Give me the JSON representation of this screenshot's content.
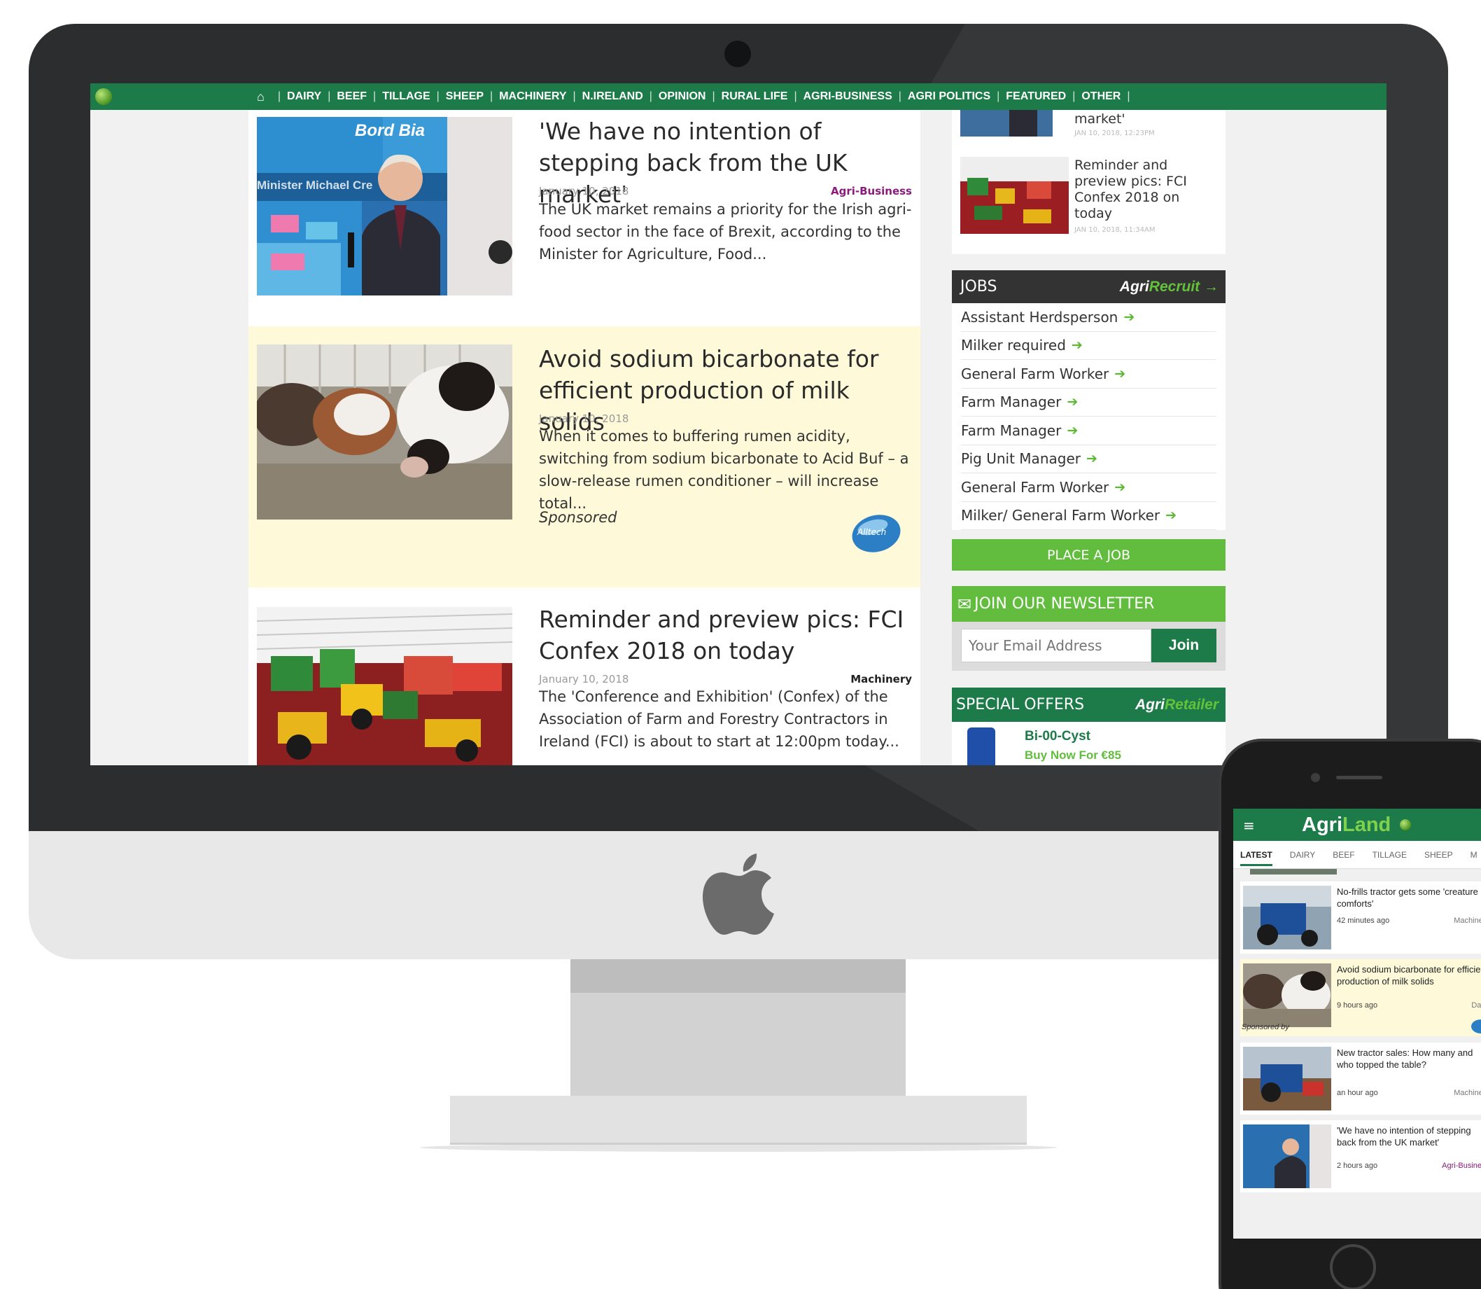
{
  "nav": {
    "home_icon": "home-icon",
    "items": [
      "DAIRY",
      "BEEF",
      "TILLAGE",
      "SHEEP",
      "MACHINERY",
      "N.IRELAND",
      "OPINION",
      "RURAL LIFE",
      "AGRI-BUSINESS",
      "AGRI POLITICS",
      "FEATURED",
      "OTHER"
    ]
  },
  "articles": [
    {
      "title": "'We have no intention of stepping back from the UK market'",
      "date": "January 10, 2018",
      "category": "Agri-Business",
      "category_color": "#8a1c7c",
      "excerpt": "The UK market remains a priority for the Irish agri-food sector in the face of Brexit, according to the Minister for Agriculture, Food...",
      "image_text": "Bord Bia",
      "image_banner": "Minister Michael Cre"
    },
    {
      "title": "Avoid sodium bicarbonate for efficient production of milk solids",
      "date": "January 10, 2018",
      "excerpt": "When it comes to buffering rumen acidity, switching from sodium bicarbonate to Acid Buf – a slow-release rumen conditioner – will increase total...",
      "sponsored_label": "Sponsored",
      "sponsor_logo_text": "Alltech"
    },
    {
      "title": "Reminder and preview pics: FCI Confex 2018 on today",
      "date": "January 10, 2018",
      "category": "Machinery",
      "category_color": "#222222",
      "excerpt": "The 'Conference and Exhibition' (Confex) of the Association of Farm and Forestry Contractors in Ireland (FCI) is about to start at 12:00pm today..."
    }
  ],
  "sidebar": {
    "recent": [
      {
        "title": "market'",
        "meta": "JAN 10, 2018, 12:23PM"
      },
      {
        "title": "Reminder and preview pics: FCI Confex 2018 on today",
        "meta": "JAN 10, 2018, 11:34AM"
      }
    ],
    "jobs": {
      "header": "JOBS",
      "brand_a": "Agri",
      "brand_b": "Recruit",
      "items": [
        "Assistant Herdsperson",
        "Milker required",
        "General Farm Worker",
        "Farm Manager",
        "Farm Manager",
        "Pig Unit Manager",
        "General Farm Worker",
        "Milker/ General Farm Worker"
      ],
      "place_job": "PLACE A JOB"
    },
    "newsletter": {
      "header": "JOIN OUR NEWSLETTER",
      "placeholder": "Your Email Address",
      "button": "Join"
    },
    "offers": {
      "header": "SPECIAL OFFERS",
      "brand_a": "Agri",
      "brand_b": "Retailer",
      "product": "Bi-00-Cyst",
      "product_sub": "Buy Now For €85"
    }
  },
  "mobile": {
    "logo_a": "Agri",
    "logo_b": "Land",
    "tabs": [
      "LATEST",
      "DAIRY",
      "BEEF",
      "TILLAGE",
      "SHEEP",
      "M"
    ],
    "cards": [
      {
        "title": "No-frills tractor gets some 'creature comforts'",
        "time": "42 minutes ago",
        "category": "Machinery"
      },
      {
        "title": "Avoid sodium bicarbonate for efficient production of milk solids",
        "time": "9 hours ago",
        "category": "Dairy",
        "sponsored": "Sponsored by"
      },
      {
        "title": "New tractor sales: How many and who topped the table?",
        "time": "an hour ago",
        "category": "Machinery"
      },
      {
        "title": "'We have no intention of stepping back from the UK market'",
        "time": "2 hours ago",
        "category": "Agri-Business"
      }
    ]
  }
}
